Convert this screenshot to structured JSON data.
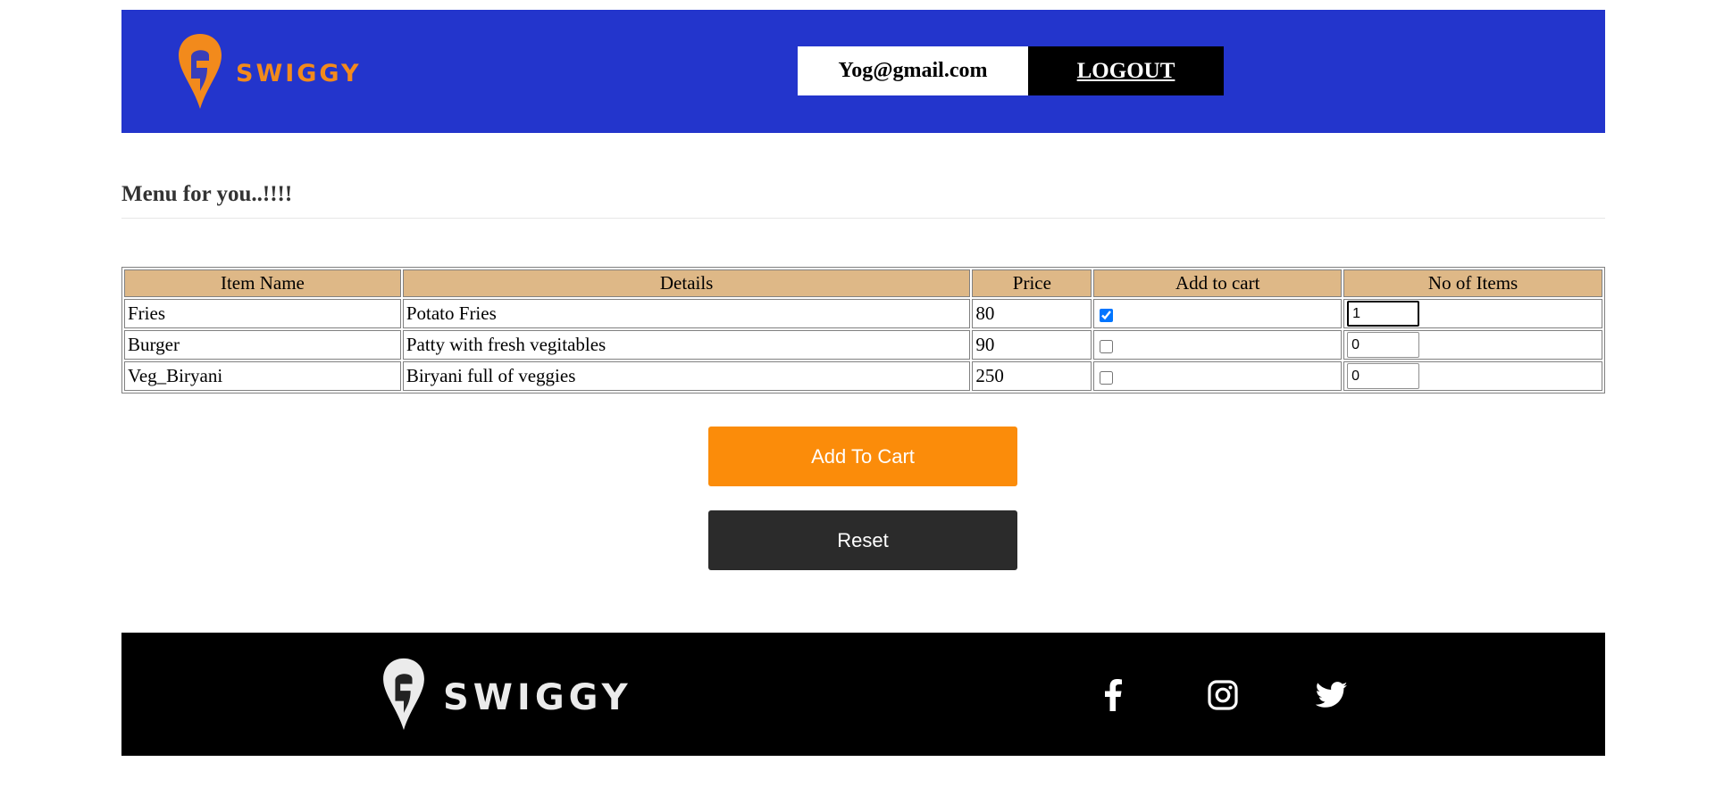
{
  "header": {
    "brand": "SWIGGY",
    "user_email": "Yog@gmail.com",
    "logout_label": "LOGOUT",
    "bg_color": "#2335cc",
    "brand_color": "#f28a1c"
  },
  "page": {
    "title": "Menu for you..!!!!"
  },
  "menu": {
    "headers": [
      "Item Name",
      "Details",
      "Price",
      "Add to cart",
      "No of Items"
    ],
    "rows": [
      {
        "name": "Fries",
        "details": "Potato Fries",
        "price": "80",
        "in_cart": true,
        "qty": "1"
      },
      {
        "name": "Burger",
        "details": "Patty with fresh vegitables",
        "price": "90",
        "in_cart": false,
        "qty": "0"
      },
      {
        "name": "Veg_Biryani",
        "details": "Biryani full of veggies",
        "price": "250",
        "in_cart": false,
        "qty": "0"
      }
    ],
    "header_bg": "#deb887"
  },
  "actions": {
    "add_label": "Add To Cart",
    "reset_label": "Reset",
    "add_color": "#fb8c0a",
    "reset_color": "#2b2b2b"
  },
  "footer": {
    "brand": "SWIGGY",
    "icons": [
      "facebook-icon",
      "instagram-icon",
      "twitter-icon"
    ]
  }
}
